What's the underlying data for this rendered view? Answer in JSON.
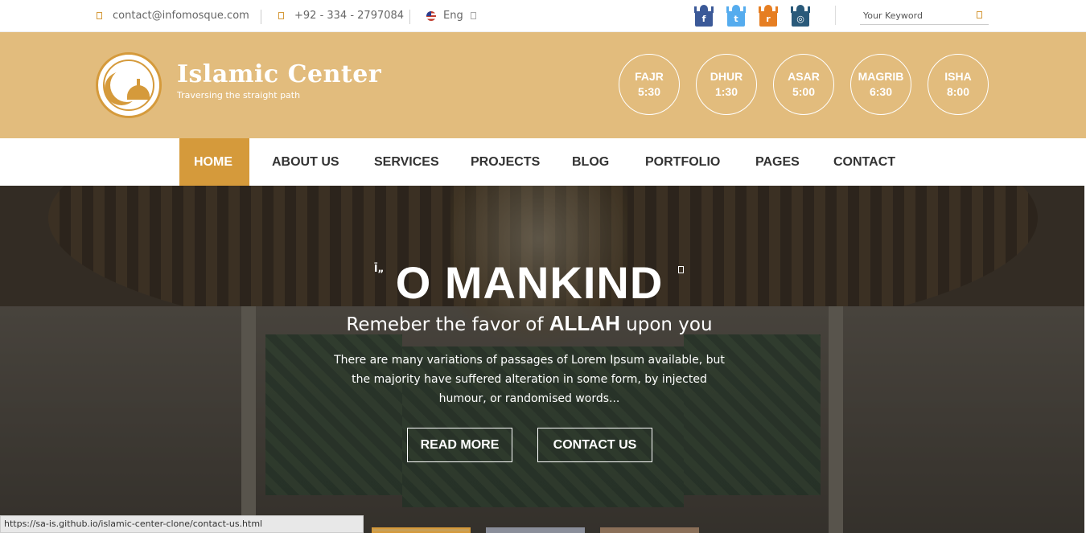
{
  "colors": {
    "brand": "#d59a3b",
    "header_band": "#e2bc7d",
    "hero_overlay": "#4a4237"
  },
  "topbar": {
    "email": "contact@infomosque.com",
    "email_icon": "envelope-icon",
    "phone": "+92 - 334 - 2797084",
    "phone_icon": "phone-icon",
    "language": "Eng",
    "language_icon": "us-flag-icon",
    "social": [
      {
        "name": "facebook-icon",
        "glyph": "f",
        "color": "#3b5998"
      },
      {
        "name": "twitter-icon",
        "glyph": "t",
        "color": "#55acee"
      },
      {
        "name": "rss-icon",
        "glyph": "r",
        "color": "#e67e22"
      },
      {
        "name": "instagram-icon",
        "glyph": "◎",
        "color": "#2a5a7a"
      }
    ],
    "search_placeholder": "Your Keyword"
  },
  "brand": {
    "title": "Islamic Center",
    "subtitle": "Traversing the straight path"
  },
  "prayers": [
    {
      "name": "FAJR",
      "time": "5:30"
    },
    {
      "name": "DHUR",
      "time": "1:30"
    },
    {
      "name": "ASAR",
      "time": "5:00"
    },
    {
      "name": "MAGRIB",
      "time": "6:30"
    },
    {
      "name": "ISHA",
      "time": "8:00"
    }
  ],
  "nav": {
    "items": [
      "HOME",
      "ABOUT US",
      "SERVICES",
      "PROJECTS",
      "BLOG",
      "PORTFOLIO",
      "PAGES",
      "CONTACT"
    ],
    "active": "HOME"
  },
  "hero": {
    "quote_open": "Ī„",
    "title": "O MANKIND",
    "subtitle_pre": "Remeber the favor of ",
    "subtitle_strong": "ALLAH",
    "subtitle_post": " upon you",
    "text": "There are many variations of passages of Lorem Ipsum available, but the majority have suffered alteration in some form, by injected humour, or randomised words...",
    "buttons": {
      "read_more": "READ MORE",
      "contact": "CONTACT US"
    }
  },
  "status_url": "https://sa-is.github.io/islamic-center-clone/contact-us.html"
}
